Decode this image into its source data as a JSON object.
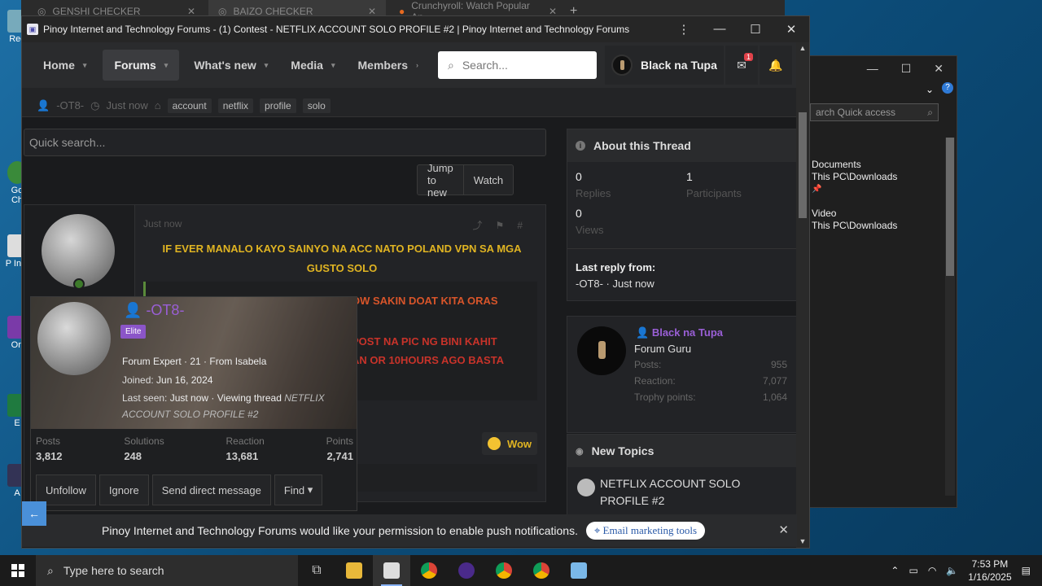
{
  "bg_tabs": [
    {
      "label": "GENSHI CHECKER",
      "active": false
    },
    {
      "label": "BAIZO CHECKER",
      "active": true
    },
    {
      "label": "Crunchyroll: Watch Popular An",
      "active": false
    }
  ],
  "desktop_icons": [
    "Rec",
    "Go Ch",
    "P Inte",
    "On",
    "E",
    "A"
  ],
  "explorer": {
    "search_placeholder": "arch Quick access",
    "items": [
      {
        "name": "Documents",
        "path": "This PC\\Downloads"
      },
      {
        "name": "Video",
        "path": "This PC\\Downloads"
      }
    ]
  },
  "window": {
    "title": "Pinoy Internet and Technology Forums - (1) Contest - NETFLIX ACCOUNT SOLO PROFILE #2 | Pinoy Internet and Technology Forums"
  },
  "nav": {
    "items": [
      "Home",
      "Forums",
      "What's new",
      "Media",
      "Members"
    ],
    "search_placeholder": "Search...",
    "username": "Black na Tupa",
    "inbox_badge": "1"
  },
  "thread": {
    "author": "-OT8-",
    "time": "Just now",
    "tags": [
      "account",
      "netflix",
      "profile",
      "solo"
    ],
    "quick_search_placeholder": "Quick search...",
    "jump_to_new": "Jump to new",
    "watch": "Watch"
  },
  "post": {
    "time": "Just now",
    "line1": "IF EVER MANALO KAYO SAINYO NA ACC NATO POLAND VPN SA MGA GUSTO SOLO",
    "line2": "OW SAKIN DOAT KITA ORAS",
    "line3a": "POST NA PIC NG BINI KAHIT",
    "line3b": "AN OR 10HOURS AGO BASTA",
    "reaction": "Wow"
  },
  "member_card": {
    "name": "-OT8-",
    "badge": "Elite",
    "info1": "Forum Expert · 21 · From Isabela",
    "joined_label": "Joined:",
    "joined": "Jun 16, 2024",
    "last_seen_label": "Last seen:",
    "last_seen": "Just now · Viewing thread",
    "last_seen_thread": "NETFLIX ACCOUNT SOLO PROFILE #2",
    "stats": [
      {
        "label": "Posts",
        "value": "3,812"
      },
      {
        "label": "Solutions",
        "value": "248"
      },
      {
        "label": "Reaction",
        "value": "13,681"
      },
      {
        "label": "Points",
        "value": "2,741"
      }
    ],
    "buttons": [
      "Unfollow",
      "Ignore",
      "Send direct message",
      "Find"
    ]
  },
  "about": {
    "title": "About this Thread",
    "replies_value": "0",
    "replies_label": "Replies",
    "participants_value": "1",
    "participants_label": "Participants",
    "views_value": "0",
    "views_label": "Views",
    "last_reply_label": "Last reply from:",
    "last_reply": "-OT8- · Just now"
  },
  "user_panel": {
    "name": "Black na Tupa",
    "title": "Forum Guru",
    "rows": [
      {
        "label": "Posts:",
        "value": "955"
      },
      {
        "label": "Reaction:",
        "value": "7,077"
      },
      {
        "label": "Trophy points:",
        "value": "1,064"
      }
    ]
  },
  "new_topics": {
    "title": "New Topics",
    "item": "NETFLIX ACCOUNT SOLO PROFILE #2"
  },
  "push": {
    "text": "Pinoy Internet and Technology Forums would like your permission to enable push notifications.",
    "button": "Email marketing tools"
  },
  "taskbar": {
    "search": "Type here to search",
    "time": "7:53 PM",
    "date": "1/16/2025"
  }
}
